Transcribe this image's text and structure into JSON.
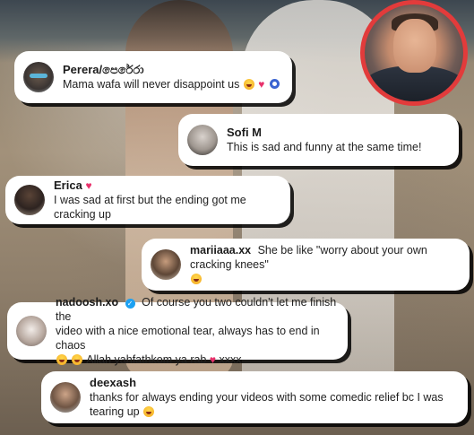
{
  "comments": [
    {
      "username": "Perera/පෙරේරා",
      "text": "Mama wafa will never disappoint us",
      "emoji_after": [
        "laughing-emoji",
        "heart",
        "blue-circle"
      ]
    },
    {
      "username": "Sofi M",
      "text": "This is sad and funny at the same time!"
    },
    {
      "username": "Erica",
      "text": "I was sad at first but the ending got me cracking up",
      "emoji_after_name": [
        "heart"
      ]
    },
    {
      "username": "mariiaaa.xx",
      "text": "She be like \"worry about your own cracking knees\""
    },
    {
      "username": "nadoosh.xo",
      "verified": true,
      "text_line1": "Of course you two couldn't let me finish the",
      "text_line2": "video with a nice emotional tear, always has to end in chaos",
      "text_line3": "Allah yahfathkom ya rab",
      "text_line3_suffix": "xxxx"
    },
    {
      "username": "deexash",
      "text": "thanks for always ending your videos with some comedic relief bc I was tearing up"
    }
  ],
  "icons": {
    "heart": "♥",
    "verified": "✓"
  },
  "colors": {
    "avatar_ring": "#e23b3b",
    "heart": "#e8316b",
    "verified": "#1da1f2"
  }
}
